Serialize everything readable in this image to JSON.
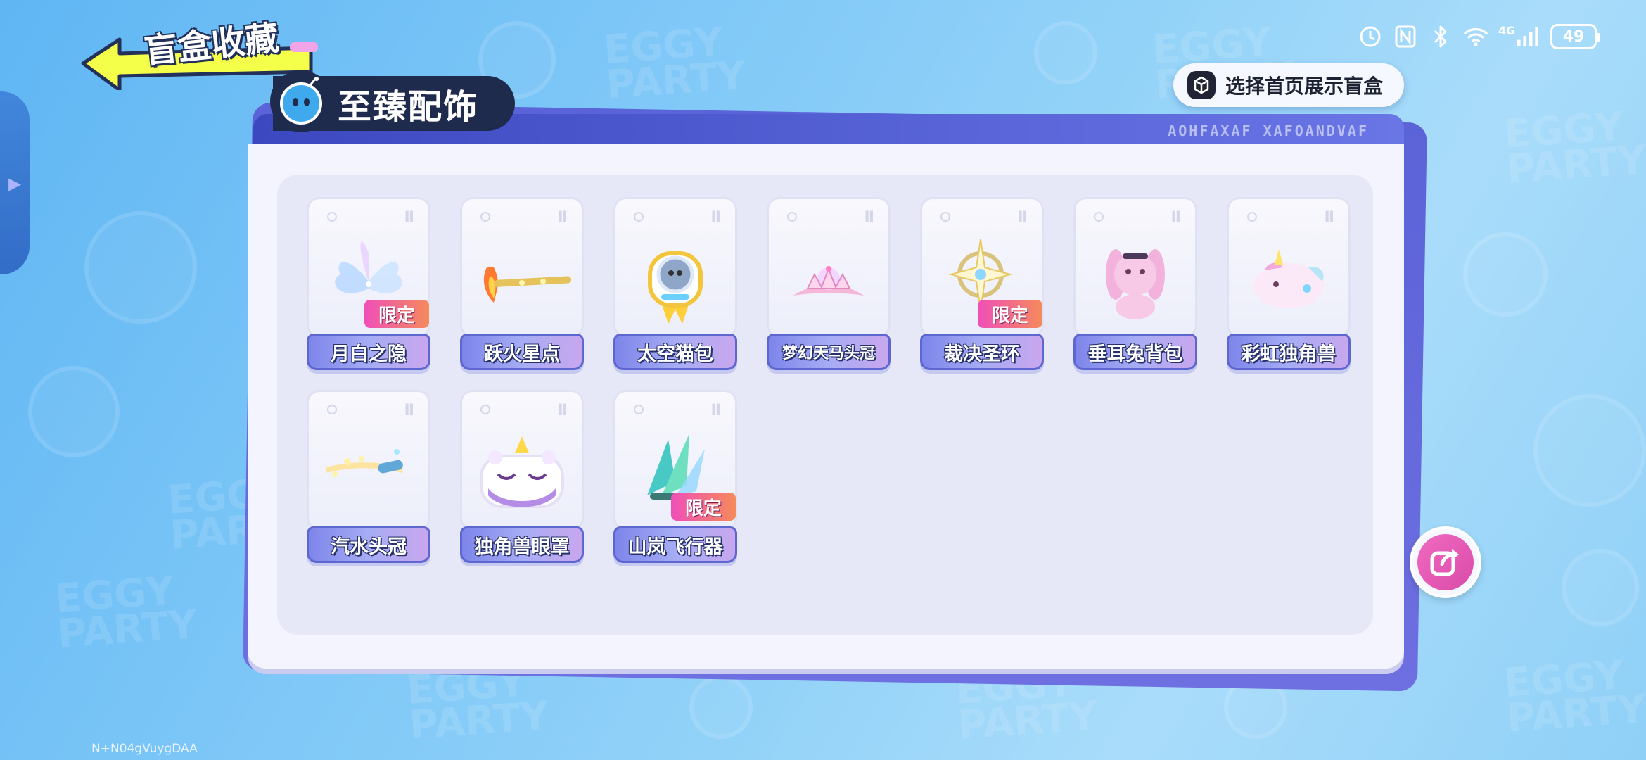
{
  "page": {
    "title": "盲盒收藏"
  },
  "status_bar": {
    "network": "4G",
    "battery": "49"
  },
  "home_button": {
    "label": "选择首页展示盲盒"
  },
  "category": {
    "label": "至臻配饰"
  },
  "panel": {
    "decor_text": "AOHFAXAF XAFOANDVAF"
  },
  "limited_label": "限定",
  "items": [
    {
      "name": "月白之隐",
      "limited": true
    },
    {
      "name": "跃火星点",
      "limited": false
    },
    {
      "name": "太空猫包",
      "limited": false
    },
    {
      "name": "梦幻天马头冠",
      "limited": false
    },
    {
      "name": "裁决圣环",
      "limited": true
    },
    {
      "name": "垂耳兔背包",
      "limited": false
    },
    {
      "name": "彩虹独角兽",
      "limited": false
    },
    {
      "name": "汽水头冠",
      "limited": false
    },
    {
      "name": "独角兽眼罩",
      "limited": false
    },
    {
      "name": "山岚飞行器",
      "limited": true
    }
  ],
  "footer": {
    "code": "N+N04gVuygDAA"
  },
  "colors": {
    "accent_pink": "#f04fb8",
    "panel_purple": "#5b63d8",
    "navy": "#1f2b4d"
  }
}
